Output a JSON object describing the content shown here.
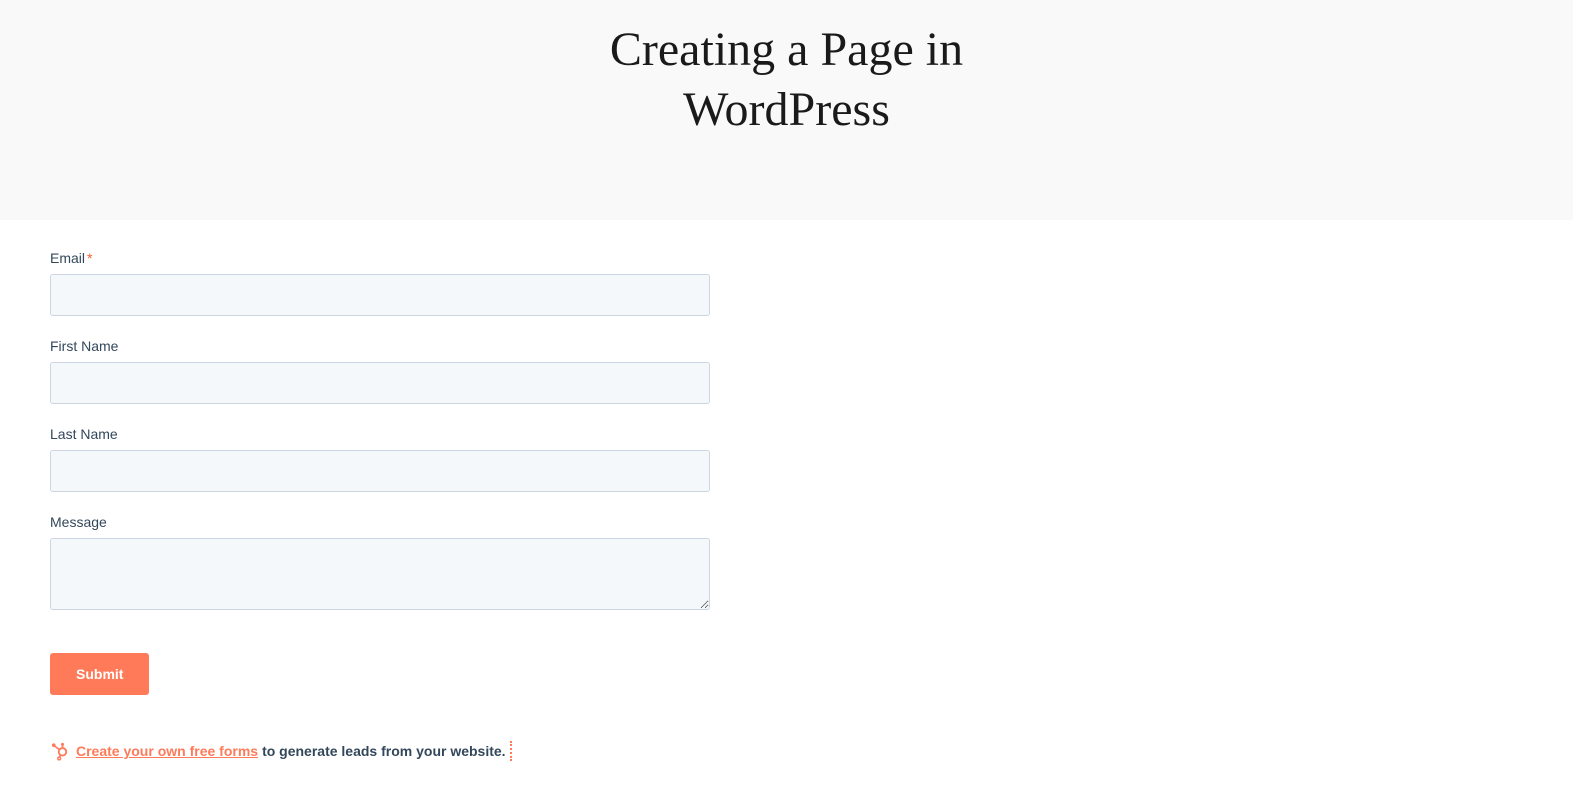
{
  "header": {
    "title": "Creating a Page in WordPress"
  },
  "form": {
    "fields": {
      "email": {
        "label": "Email",
        "required": true,
        "value": ""
      },
      "firstName": {
        "label": "First Name",
        "required": false,
        "value": ""
      },
      "lastName": {
        "label": "Last Name",
        "required": false,
        "value": ""
      },
      "message": {
        "label": "Message",
        "required": false,
        "value": ""
      }
    },
    "submit_label": "Submit"
  },
  "promo": {
    "link_text": "Create your own free forms",
    "tail_text": " to generate leads from your website."
  }
}
